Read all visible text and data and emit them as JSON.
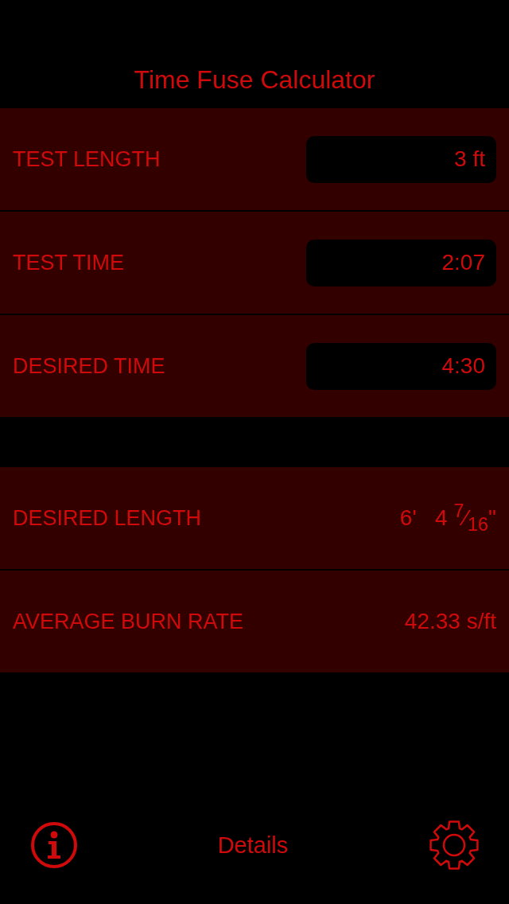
{
  "title": "Time Fuse Calculator",
  "inputs": [
    {
      "label": "TEST LENGTH",
      "value": "3 ft"
    },
    {
      "label": "TEST TIME",
      "value": "2:07"
    },
    {
      "label": "DESIRED TIME",
      "value": "4:30"
    }
  ],
  "results": [
    {
      "label": "DESIRED LENGTH",
      "value": "6'   4 $^{7}$⁄$_{16}$\""
    },
    {
      "label": "AVERAGE BURN RATE",
      "value": "42.33 s/ft"
    }
  ],
  "toolbar": {
    "center_label": "Details"
  }
}
